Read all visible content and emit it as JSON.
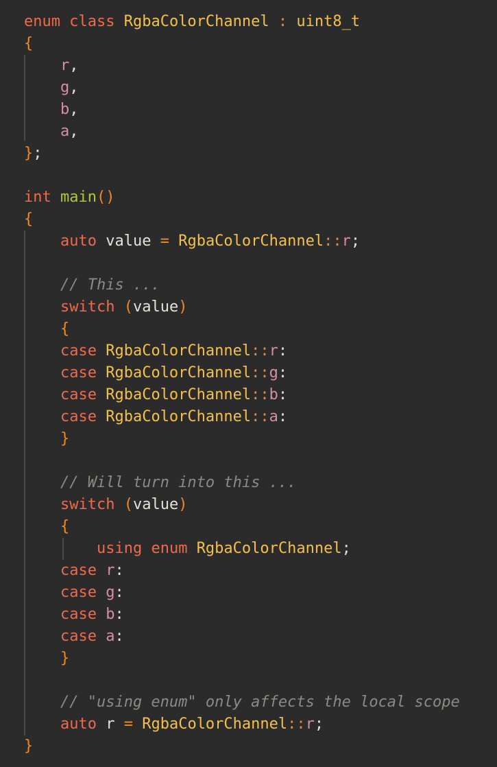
{
  "editor": {
    "theme": {
      "background": "#2b2b2b",
      "keyword": "#f06a4a",
      "type": "#f5c04a",
      "function": "#b8c33a",
      "bracket": "#f08a24",
      "member": "#d98ca4",
      "text": "#e8e2d6",
      "comment": "#8e8a82",
      "guide": "#4a4a4a"
    },
    "lines": [
      [
        [
          "kw",
          "enum"
        ],
        [
          "sp",
          " "
        ],
        [
          "kw",
          "class"
        ],
        [
          "sp",
          " "
        ],
        [
          "type",
          "RgbaColorChannel"
        ],
        [
          "sp",
          " "
        ],
        [
          "op",
          ":"
        ],
        [
          "sp",
          " "
        ],
        [
          "type",
          "uint8_t"
        ]
      ],
      [
        [
          "br",
          "{"
        ]
      ],
      [
        [
          "sp",
          "    "
        ],
        [
          "mem",
          "r"
        ],
        [
          "txt",
          ","
        ]
      ],
      [
        [
          "sp",
          "    "
        ],
        [
          "mem",
          "g"
        ],
        [
          "txt",
          ","
        ]
      ],
      [
        [
          "sp",
          "    "
        ],
        [
          "mem",
          "b"
        ],
        [
          "txt",
          ","
        ]
      ],
      [
        [
          "sp",
          "    "
        ],
        [
          "mem",
          "a"
        ],
        [
          "txt",
          ","
        ]
      ],
      [
        [
          "br",
          "}"
        ],
        [
          "txt",
          ";"
        ]
      ],
      [],
      [
        [
          "kw",
          "int"
        ],
        [
          "sp",
          " "
        ],
        [
          "fn",
          "main"
        ],
        [
          "br",
          "()"
        ]
      ],
      [
        [
          "br",
          "{"
        ]
      ],
      [
        [
          "sp",
          "    "
        ],
        [
          "kw",
          "auto"
        ],
        [
          "sp",
          " "
        ],
        [
          "txt",
          "value"
        ],
        [
          "sp",
          " "
        ],
        [
          "op",
          "="
        ],
        [
          "sp",
          " "
        ],
        [
          "type",
          "RgbaColorChannel"
        ],
        [
          "op",
          "::"
        ],
        [
          "mem",
          "r"
        ],
        [
          "txt",
          ";"
        ]
      ],
      [],
      [
        [
          "sp",
          "    "
        ],
        [
          "cmt",
          "// This ..."
        ]
      ],
      [
        [
          "sp",
          "    "
        ],
        [
          "kw",
          "switch"
        ],
        [
          "sp",
          " "
        ],
        [
          "br",
          "("
        ],
        [
          "txt",
          "value"
        ],
        [
          "br",
          ")"
        ]
      ],
      [
        [
          "sp",
          "    "
        ],
        [
          "br",
          "{"
        ]
      ],
      [
        [
          "sp",
          "    "
        ],
        [
          "kw",
          "case"
        ],
        [
          "sp",
          " "
        ],
        [
          "type",
          "RgbaColorChannel"
        ],
        [
          "op",
          "::"
        ],
        [
          "mem",
          "r"
        ],
        [
          "txt",
          ":"
        ]
      ],
      [
        [
          "sp",
          "    "
        ],
        [
          "kw",
          "case"
        ],
        [
          "sp",
          " "
        ],
        [
          "type",
          "RgbaColorChannel"
        ],
        [
          "op",
          "::"
        ],
        [
          "mem",
          "g"
        ],
        [
          "txt",
          ":"
        ]
      ],
      [
        [
          "sp",
          "    "
        ],
        [
          "kw",
          "case"
        ],
        [
          "sp",
          " "
        ],
        [
          "type",
          "RgbaColorChannel"
        ],
        [
          "op",
          "::"
        ],
        [
          "mem",
          "b"
        ],
        [
          "txt",
          ":"
        ]
      ],
      [
        [
          "sp",
          "    "
        ],
        [
          "kw",
          "case"
        ],
        [
          "sp",
          " "
        ],
        [
          "type",
          "RgbaColorChannel"
        ],
        [
          "op",
          "::"
        ],
        [
          "mem",
          "a"
        ],
        [
          "txt",
          ":"
        ]
      ],
      [
        [
          "sp",
          "    "
        ],
        [
          "br",
          "}"
        ]
      ],
      [],
      [
        [
          "sp",
          "    "
        ],
        [
          "cmt",
          "// Will turn into this ..."
        ]
      ],
      [
        [
          "sp",
          "    "
        ],
        [
          "kw",
          "switch"
        ],
        [
          "sp",
          " "
        ],
        [
          "br",
          "("
        ],
        [
          "txt",
          "value"
        ],
        [
          "br",
          ")"
        ]
      ],
      [
        [
          "sp",
          "    "
        ],
        [
          "br",
          "{"
        ]
      ],
      [
        [
          "sp",
          "        "
        ],
        [
          "kw",
          "using"
        ],
        [
          "sp",
          " "
        ],
        [
          "kw",
          "enum"
        ],
        [
          "sp",
          " "
        ],
        [
          "type",
          "RgbaColorChannel"
        ],
        [
          "txt",
          ";"
        ]
      ],
      [
        [
          "sp",
          "    "
        ],
        [
          "kw",
          "case"
        ],
        [
          "sp",
          " "
        ],
        [
          "mem",
          "r"
        ],
        [
          "txt",
          ":"
        ]
      ],
      [
        [
          "sp",
          "    "
        ],
        [
          "kw",
          "case"
        ],
        [
          "sp",
          " "
        ],
        [
          "mem",
          "g"
        ],
        [
          "txt",
          ":"
        ]
      ],
      [
        [
          "sp",
          "    "
        ],
        [
          "kw",
          "case"
        ],
        [
          "sp",
          " "
        ],
        [
          "mem",
          "b"
        ],
        [
          "txt",
          ":"
        ]
      ],
      [
        [
          "sp",
          "    "
        ],
        [
          "kw",
          "case"
        ],
        [
          "sp",
          " "
        ],
        [
          "mem",
          "a"
        ],
        [
          "txt",
          ":"
        ]
      ],
      [
        [
          "sp",
          "    "
        ],
        [
          "br",
          "}"
        ]
      ],
      [],
      [
        [
          "sp",
          "    "
        ],
        [
          "cmt",
          "// \"using enum\" only affects the local scope"
        ]
      ],
      [
        [
          "sp",
          "    "
        ],
        [
          "kw",
          "auto"
        ],
        [
          "sp",
          " "
        ],
        [
          "txt",
          "r"
        ],
        [
          "sp",
          " "
        ],
        [
          "op",
          "="
        ],
        [
          "sp",
          " "
        ],
        [
          "type",
          "RgbaColorChannel"
        ],
        [
          "op",
          "::"
        ],
        [
          "mem",
          "r"
        ],
        [
          "txt",
          ";"
        ]
      ],
      [
        [
          "br",
          "}"
        ]
      ]
    ]
  }
}
